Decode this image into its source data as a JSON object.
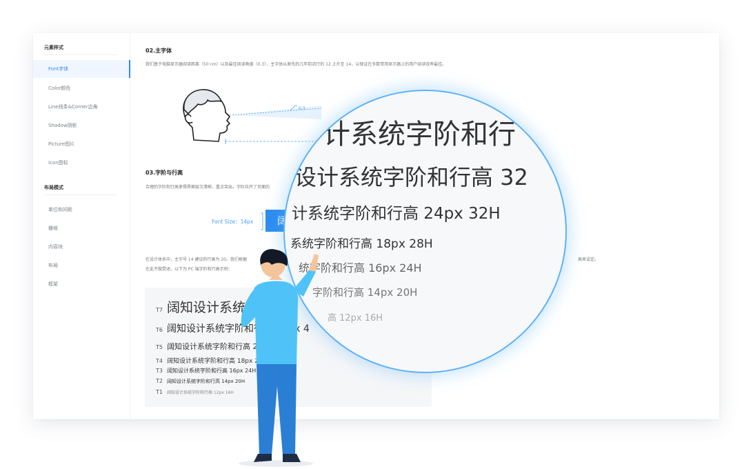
{
  "sidebar": {
    "groups": [
      {
        "title": "元素样式",
        "items": [
          "Font字体",
          "Color颜色",
          "Line线条&Corner边角",
          "Shadow阴影",
          "Picture图片",
          "Icon图标"
        ]
      },
      {
        "title": "布局模式",
        "items": [
          "单位和间距",
          "栅格",
          "内容块",
          "布局",
          "框架"
        ]
      }
    ],
    "active_item": "Font字体"
  },
  "section_font": {
    "title": "02.主字体",
    "desc": "我们基于电脑显示器阅读距离（50 cm）以及最佳阅读角度（0.3），主字体从原先的几年前流行的 12 上升至 14，以保证在多数常用显示器上的用户阅读效率最佳。",
    "angle_label": "0.3",
    "distance_label": "50cm"
  },
  "section_scale": {
    "title": "03.字阶与行高",
    "desc": "合理的字阶和行高使得界面层次清晰、重点突出。字阶拉开了页面的",
    "font_size_label": "Font Size：",
    "font_size_value": "14px",
    "demo_text": "阔知",
    "body1": "在设计体系中，主字号 14 建议的行高为 20。我们根据",
    "body1_tail": "高来设定。",
    "body2": "在此不做赘述。以下为 PC 端字阶和行高示例："
  },
  "type_scale": [
    {
      "tag": "T7",
      "text": "阔知设计系统"
    },
    {
      "tag": "T6",
      "text": "阔知设计系统字阶和行高 32px 4"
    },
    {
      "tag": "T5",
      "text": "阔知设计系统字阶和行高 24px 32H"
    },
    {
      "tag": "T4",
      "text": "阔知设计系统字阶和行高 18px 28H"
    },
    {
      "tag": "T3",
      "text": "阔知设计系统字阶和行高 16px 24H"
    },
    {
      "tag": "T2",
      "text": "阔知设计系统字阶和行高 14px 20H"
    },
    {
      "tag": "T1",
      "text": "阔知设计系统字阶和行高 12px 16H"
    }
  ],
  "magnifier_lines": [
    "计系统字阶和行",
    "设计系统字阶和行高 32",
    "计系统字阶和行高 24px 32H",
    "系统字阶和行高 18px 28H",
    "统字阶和行高 16px 24H",
    "字阶和行高 14px 20H",
    "高 12px 16H"
  ],
  "colors": {
    "accent": "#2d8cf0",
    "shirt": "#4fc3f7",
    "pants": "#2a7fd4"
  }
}
